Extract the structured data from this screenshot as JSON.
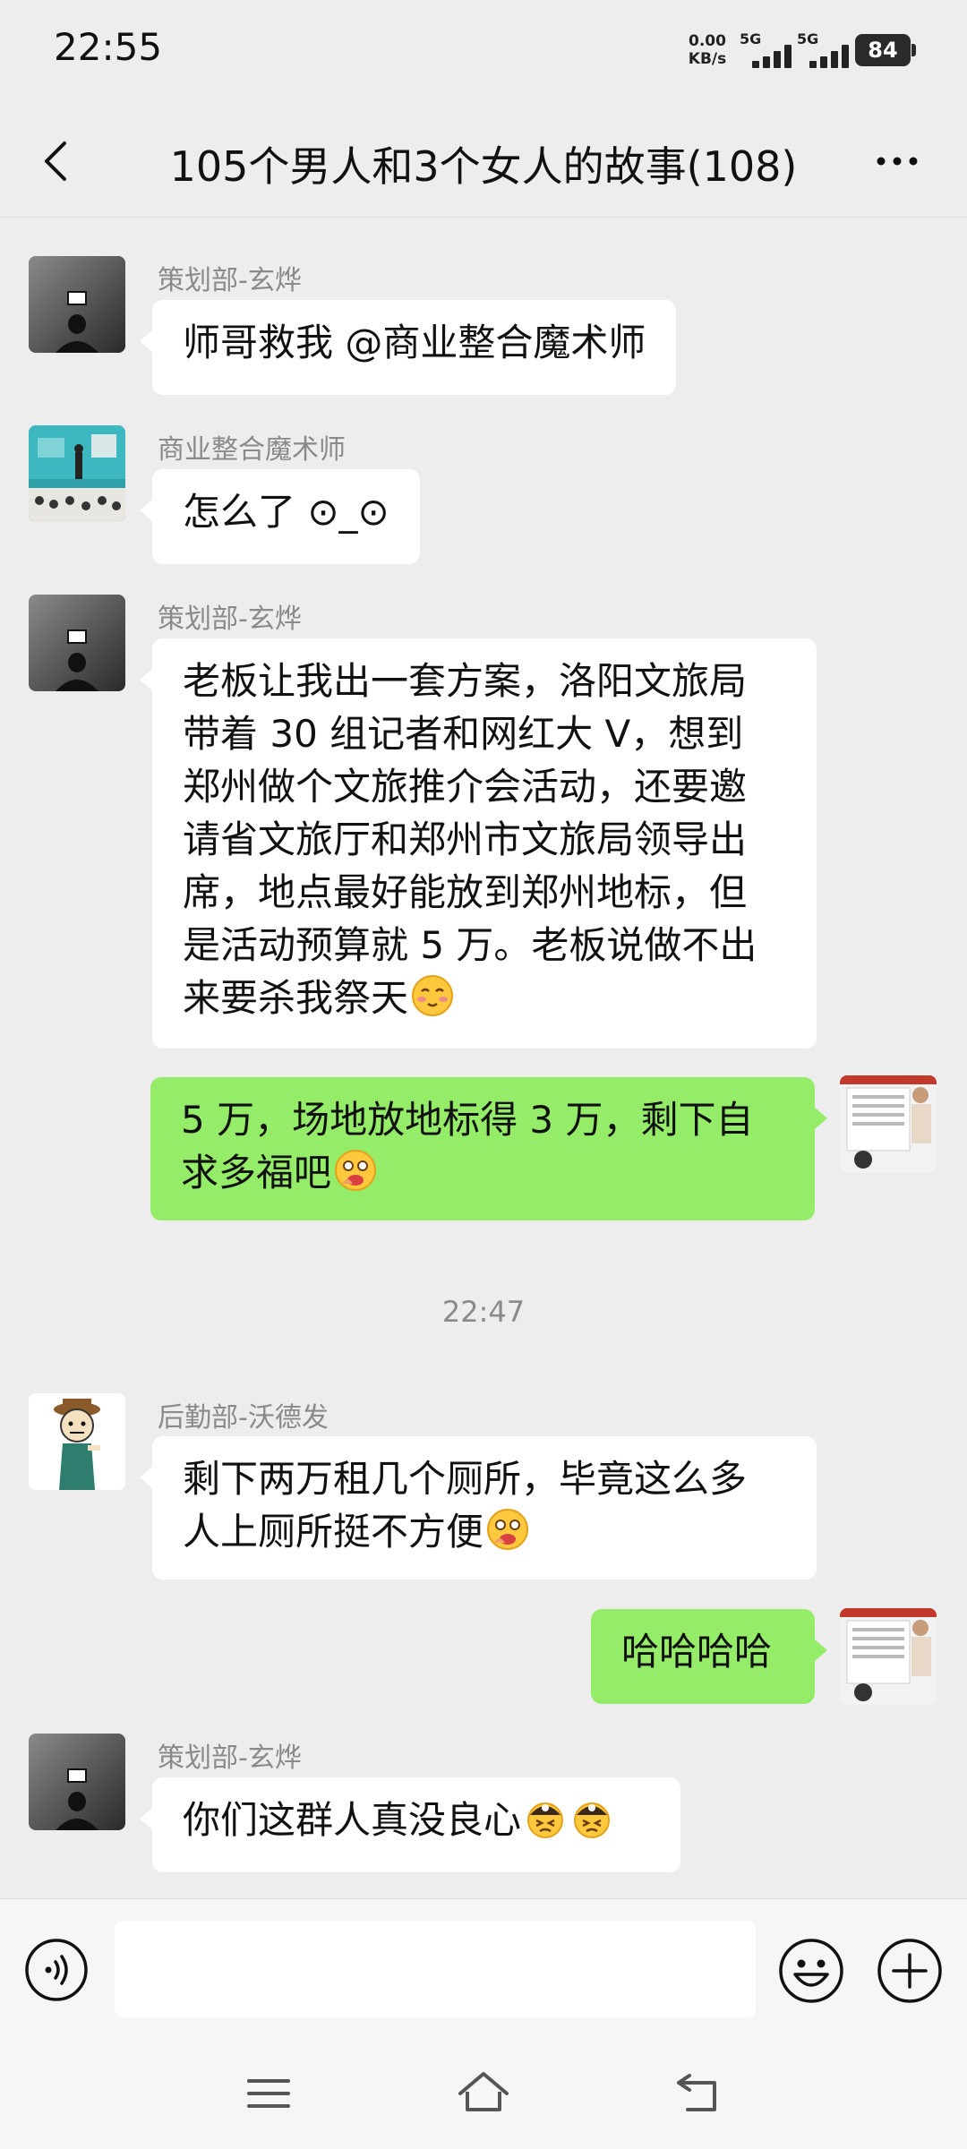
{
  "status_bar": {
    "time": "22:55",
    "net_speed_value": "0.00",
    "net_speed_unit": "KB/s",
    "sim1_label": "5G",
    "sim2_label": "5G",
    "battery": "84"
  },
  "nav": {
    "title": "105个男人和3个女人的故事(108)"
  },
  "messages": [
    {
      "sender": "策划部-玄烨",
      "text": "师哥救我 @商业整合魔术师"
    },
    {
      "sender": "商业整合魔术师",
      "text": "怎么了 ⊙_⊙"
    },
    {
      "sender": "策划部-玄烨",
      "lines": [
        "老板让我出一套方案，洛阳文旅局",
        "带着 30 组记者和网红大 V，想到",
        "郑州做个文旅推介会活动，还要邀",
        "请省文旅厅和郑州市文旅局领导出",
        "席，地点最好能放到郑州地标，但",
        "是活动预算就 5 万。老板说做不出",
        "来要杀我祭天"
      ]
    },
    {
      "lines": [
        "5 万，场地放地标得 3 万，剩下自",
        "求多福吧"
      ]
    },
    {
      "sender": "后勤部-沃德发",
      "lines": [
        "剩下两万租几个厕所，毕竟这么多",
        "人上厕所挺不方便"
      ]
    },
    {
      "text": "哈哈哈哈"
    },
    {
      "sender": "策划部-玄烨",
      "text": "你们这群人真没良心"
    }
  ],
  "timestamp": "22:47",
  "input": {
    "value": ""
  },
  "icons": {
    "back": "back-arrow-icon",
    "more": "more-icon",
    "voice": "voice-icon",
    "emoji": "emoji-icon",
    "plus": "plus-icon",
    "menu": "menu-icon",
    "home": "home-icon",
    "back_nav": "back-icon"
  },
  "colors": {
    "background": "#ededed",
    "incoming_bubble": "#ffffff",
    "outgoing_bubble": "#95ec69",
    "sender_name": "#8a8a8a"
  }
}
